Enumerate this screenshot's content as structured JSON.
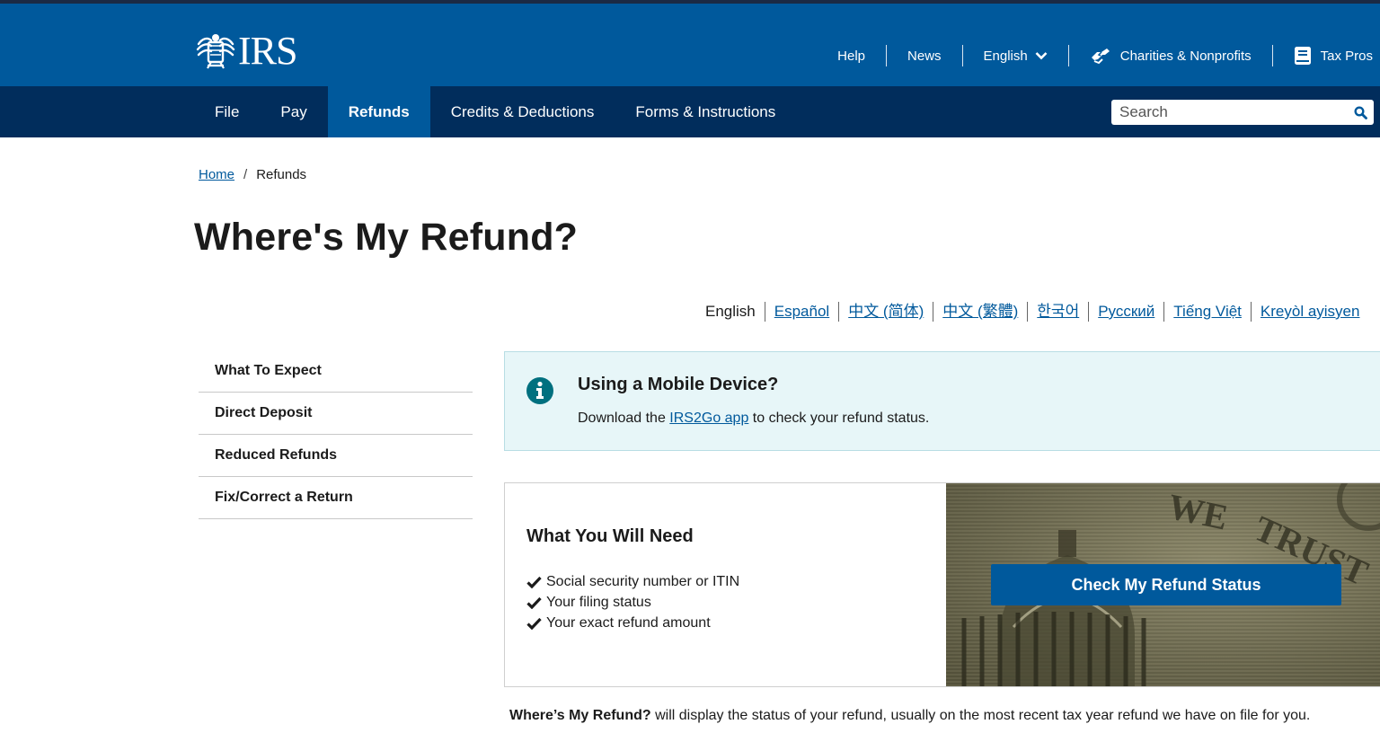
{
  "brand": {
    "logo_text": "IRS"
  },
  "utility_nav": {
    "help": "Help",
    "news": "News",
    "language": "English",
    "charities": "Charities & Nonprofits",
    "tax_pros": "Tax Pros"
  },
  "main_nav": {
    "items": [
      {
        "label": "File",
        "active": false
      },
      {
        "label": "Pay",
        "active": false
      },
      {
        "label": "Refunds",
        "active": true
      },
      {
        "label": "Credits & Deductions",
        "active": false
      },
      {
        "label": "Forms & Instructions",
        "active": false
      }
    ]
  },
  "search": {
    "placeholder": "Search"
  },
  "breadcrumb": {
    "home": "Home",
    "separator": "/",
    "current": "Refunds"
  },
  "page": {
    "title": "Where's My Refund?"
  },
  "languages": {
    "current": "English",
    "links": [
      "Español",
      "中文 (简体)",
      "中文 (繁體)",
      "한국어",
      "Русский",
      "Tiếng Việt",
      "Kreyòl ayisyen"
    ]
  },
  "sidenav": {
    "items": [
      "What To Expect",
      "Direct Deposit",
      "Reduced Refunds",
      "Fix/Correct a Return"
    ]
  },
  "alert": {
    "title": "Using a Mobile Device?",
    "body_before": "Download the ",
    "link": "IRS2Go app",
    "body_after": " to check your refund status."
  },
  "need": {
    "title": "What You Will Need",
    "items": [
      "Social security number or ITIN",
      "Your filing status",
      "Your exact refund amount"
    ]
  },
  "cta": {
    "label": "Check My Refund Status"
  },
  "description": {
    "bold": "Where’s My Refund?",
    "text": " will display the status of your refund, usually on the most recent tax year refund we have on file for you."
  },
  "colors": {
    "header_blue": "#00599c",
    "nav_navy": "#012d5c",
    "alert_bg": "#e7f6f8",
    "alert_icon": "#00707f"
  }
}
